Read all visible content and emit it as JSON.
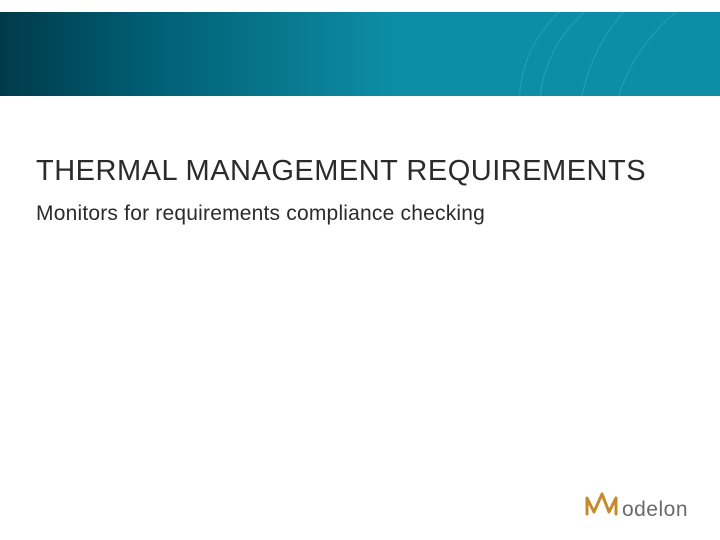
{
  "title": "THERMAL MANAGEMENT REQUIREMENTS",
  "subtitle": "Monitors for requirements compliance checking",
  "brand": {
    "name_suffix": "odelon",
    "colors": {
      "banner_gradient_from": "#003a4a",
      "banner_gradient_to": "#0d8ea6",
      "logo_glyph": "#c58a2e",
      "logo_text": "#6a6a6a"
    }
  }
}
